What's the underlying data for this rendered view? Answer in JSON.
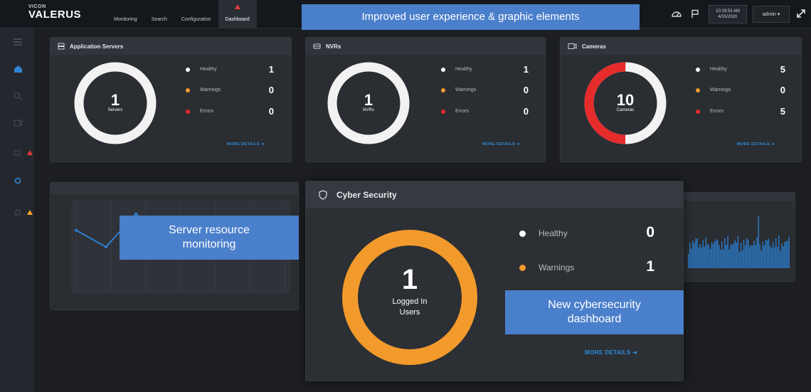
{
  "app": {
    "brand_sub": "VICON",
    "brand_name": "VALERUS"
  },
  "nav": {
    "tabs": [
      "Monitoring",
      "Search",
      "Configuration",
      "Dashboard"
    ]
  },
  "header": {
    "time": "10:19:53 AM",
    "date": "4/15/2020",
    "user": "admin ▾"
  },
  "callouts": {
    "top": "Improved user experience & graphic elements",
    "left": "Server resource monitoring",
    "right": "New cybersecurity dashboard"
  },
  "app_servers": {
    "title": "Application Servers",
    "center_value": "1",
    "center_label": "Servers",
    "healthy_label": "Healthy",
    "healthy": "1",
    "warnings_label": "Warnings",
    "warnings": "0",
    "errors_label": "Errors",
    "errors": "0",
    "more": "MORE DETAILS ➜"
  },
  "nvrs": {
    "title": "NVRs",
    "center_value": "1",
    "center_label": "NVRs",
    "healthy_label": "Healthy",
    "healthy": "1",
    "warnings_label": "Warnings",
    "warnings": "0",
    "errors_label": "Errors",
    "errors": "0",
    "more": "MORE DETAILS ➜"
  },
  "cameras": {
    "title": "Cameras",
    "center_value": "10",
    "center_label": "Cameras",
    "healthy_label": "Healthy",
    "healthy": "5",
    "warnings_label": "Warnings",
    "warnings": "0",
    "errors_label": "Errors",
    "errors": "5",
    "more": "MORE DETAILS ➜",
    "error_fraction": 0.5
  },
  "cyber": {
    "title": "Cyber Security",
    "center_value": "1",
    "center_label": "Logged In Users",
    "healthy_label": "Healthy",
    "healthy": "0",
    "warnings_label": "Warnings",
    "warnings": "1",
    "more": "MORE DETAILS ➜"
  },
  "colors": {
    "healthy": "#ffffff",
    "warning": "#f39a2c",
    "error": "#e62b2b",
    "accent": "#2d8fe0",
    "callout": "#4a7fcb"
  },
  "chart_data": {
    "type": "line",
    "title": "",
    "series": [
      {
        "values": [
          7,
          5,
          9,
          6,
          8,
          4,
          6,
          5
        ]
      }
    ]
  }
}
